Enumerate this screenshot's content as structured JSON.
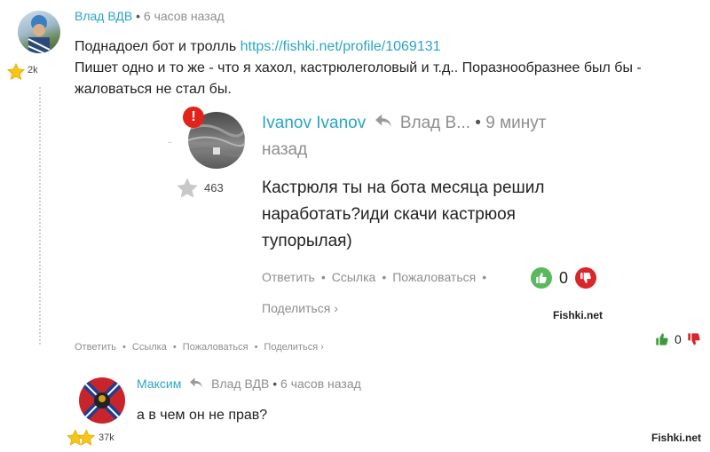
{
  "comment1": {
    "author": "Влад ВДВ",
    "time": "6 часов назад",
    "karma": "2k",
    "text_intro": "Поднадоел бот и тролль ",
    "link": "https://fishki.net/profile/1069131",
    "text_line2": "Пишет одно и то же - что я хахол, кастрюлеголовый и т.д.. Поразнообразнее был бы -",
    "text_line3": "жаловаться не стал бы.",
    "actions": [
      "Ответить",
      "Ссылка",
      "Пожаловаться",
      "Поделиться ›"
    ],
    "vote_count": "0"
  },
  "quote": {
    "author": "Ivanov Ivanov",
    "reply_to": "Влад В...",
    "time_line1": "9 минут",
    "time_line2": "назад",
    "badge": "!",
    "karma": "463",
    "text_line1": "Кастрюля ты на бота месяца решил",
    "text_line2": "наработать?иди скачи кастрюоя",
    "text_line3": "тупорылая)",
    "actions": [
      "Ответить",
      "Ссылка",
      "Пожаловаться"
    ],
    "share": "Поделиться ›",
    "vote_count": "0",
    "watermark": "Fishki.net"
  },
  "comment2": {
    "author": "Максим",
    "reply_to": "Влад ВДВ",
    "time": "6 часов назад",
    "karma": "37k",
    "text": "а в чем он не прав?",
    "watermark": "Fishki.net"
  },
  "colors": {
    "accent": "#2aa6c4",
    "upvote": "#5cb85c",
    "downvote": "#d9262b",
    "star": "#f5c518"
  }
}
